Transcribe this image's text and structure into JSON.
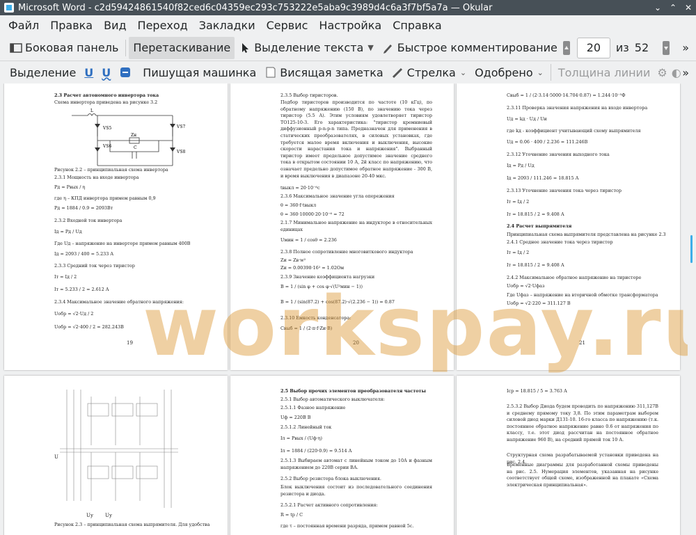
{
  "window": {
    "title": "Microsoft Word - c2d59424861540f82ced6c04359ec293c753222e5aba9c3989d4c6a3f7bf5a7a — Okular",
    "controls": [
      "⌄",
      "⌃",
      "✕"
    ]
  },
  "menu": [
    "Файл",
    "Правка",
    "Вид",
    "Переход",
    "Закладки",
    "Сервис",
    "Настройка",
    "Справка"
  ],
  "toolbar": {
    "sidebar": "Боковая панель",
    "drag": "Перетаскивание",
    "text_select": "Выделение текста",
    "quick_comment": "Быстрое комментирование",
    "page_current": "20",
    "page_of": "из",
    "page_total": "52"
  },
  "annot_toolbar": {
    "highlight": "Выделение",
    "underline1": "U",
    "underline2": "U",
    "typewriter": "Пишущая машинка",
    "note": "Висящая заметка",
    "arrow": "Стрелка",
    "stamp": "Одобрено",
    "line_width": "Толщина линии"
  },
  "watermark": "workspay.ru",
  "pages": {
    "p19": {
      "number": "19",
      "lines": [
        "2.3 Расчет автономного инвертора тока",
        "Схема инвертора приведена на рисунке 3.2",
        "Рисунок 2.2 – принципиальная схема инвертора",
        "2.3.1 Мощность на входе инвертора",
        "Pд = Pвых / η",
        "где η – КПД инвертора примем равным 0,9",
        "Pд = 1884 / 0.9 = 2093Вт",
        "2.3.2 Входной ток инвертора",
        "Iд = Pд / Uд",
        "Где Uд – напряжение на инверторе примем равным 400В",
        "Iд = 2093 / 400 = 5.233 А",
        "2.3.3 Средний ток через тиристор",
        "Iт = Iд / 2",
        "Iт = 5.233 / 2 = 2.612 А",
        "2.3.4 Максимальное значение обратного напряжения:",
        "Uобр = √2·Uд / 2",
        "Uобр = √2·400 / 2 = 282.243В"
      ],
      "labels": [
        "L",
        "VS5",
        "VS7",
        "Zн",
        "VS6",
        "C",
        "VS8"
      ]
    },
    "p20": {
      "number": "20",
      "lines": [
        "2.3.5 Выбор тиристоров.",
        "Подбор тиристоров производится по частоте (10 кГц), по обратному напряжению (150 В), по значению тока через тиристор (5.5 А). Этим условиям удовлетворяет тиристор ТО125-10-3. Его характеристика: \"тиристор кремниевый диффузионный p-n-p-n типа. Предназначен для применения в статических преобразователях, в силовых установках, где требуется малое время включения и выключения, высокие скорости нарастания тока и напряжения\". Выбранный тиристор имеет предельное допустимое значение среднего тока в открытом состоянии 10 А, 2й класс по напряжению, что означает предельно допустимое обратное напряжение - 300 В, и время выключения в диапазоне 20-40 мкс.",
        "tвыкл = 20·10⁻⁶с",
        "2.3.6 Максимальное значение угла опережения",
        "θ = 360·f·tвыкл",
        "θ = 360·10000·20·10⁻⁶ = 72",
        "2.1.7 Минимальное напряжение на индукторе в относительных единицах",
        "Uмин = 1 / cosθ = 2.236",
        "2.3.8 Полное сопротивление многовиткового индуктора",
        "Zи = Zв·w²",
        "Zи = 0.00398·16² = 1.02Ом",
        "2.3.9 Значение коэффициента нагрузки",
        "B = 1 / (sin φ + cos φ·√(U²мин − 1))",
        "B = 1 / (sin(87.2) + cos(87.2)·√(2.236 − 1)) = 0.87",
        "2.3.10 Емкость конденсатора:",
        "Cвыб = 1 / (2·π·f·Zи·B)"
      ]
    },
    "p21": {
      "number": "21",
      "lines": [
        "Cвыб = 1 / (2·3.14·5000·14.704·0.87) = 1.244·10⁻⁵Ф",
        "2.3.11 Проверка значения напряжения на входе инвертора",
        "Uд = kд · Uд / Uи",
        "где kд - коэффициент учитывающий схему выпрямителя",
        "Uд = 0.06 · 400 / 2.236 = 111.246В",
        "2.3.12 Уточнение значения выходного тока",
        "Iд = Pд / Uд",
        "Iд = 2093 / 111.246 = 18.815 А",
        "2.3.13 Уточнение значения тока через тиристор",
        "Iт = Iд / 2",
        "Iт = 18.815 / 2 = 9.408 А",
        "2.4 Расчет выпрямителя",
        "Принципиальная схема выпрямителя представлена на рисунке 2.3",
        "2.4.1 Среднее значение тока через тиристор",
        "Iт = Iд / 2",
        "Iт = 18.815 / 2 = 9.408 А",
        "2.4.2 Максимальное обратное напряжение на тиристоре",
        "Uобр = √2·Uфаз",
        "Где Uфаз – напряжение на вторичной обмотке трансформатора",
        "Uобр = √2·220 = 311.127 В"
      ]
    },
    "p22": {
      "lines": [
        "U",
        "Uу",
        "Uу",
        "Рисунок 2.3 – принципиальная схема выпрямителя. Для удобства"
      ]
    },
    "p23": {
      "lines": [
        "2.5 Выбор прочих элементов преобразователя частоты",
        "2.5.1 Выбор автоматического выключателя:",
        "2.5.1.1 Фазное напряжение",
        "Uф = 220В В",
        "2.5.1.2 Линейный ток",
        "Iл = Pвых / (Uф·η)",
        "Iл = 1884 / (220·0.9) = 9.514 А",
        "2.5.1.3 Выбираем автомат с линейным током до 10А и фазным напряжением до 220В серии ВА.",
        "2.5.2 Выбор резистора блока выключения.",
        "Блок выключения состоит из последовательного соединения резистора и диода.",
        "2.5.2.1 Расчет активного сопротивления:",
        "R = tр / C",
        "где τ – постоянная времени разряда, примем равной 5с."
      ]
    },
    "p24": {
      "lines": [
        "Iср = 18.815 / 5 = 3.763 А",
        "2.5.3.2 Выбор Диода будем проводить по напряжению 311,127В и среднему прямому току 3,8. По этим параметрам выберем силовой диод марки Д131-10. 16-го класса по напряжению (т.к. постоянное обратное напряжение равно 0.6 от напряжения по классу, т.е. этот диод рассчитан на постоянное обратное напряжение 960 В), на средний прямой ток 10 А.",
        "Структурная схема разрабатываемой установки приведена на рис. 2.4.",
        "Временные диаграммы для разработанной схемы приведены на рис. 2.5. Нумерация элементов, указанная на рисунке соответствует общей схеме, изображенной на плакате «Схема электрическая принципиальная»."
      ]
    }
  }
}
